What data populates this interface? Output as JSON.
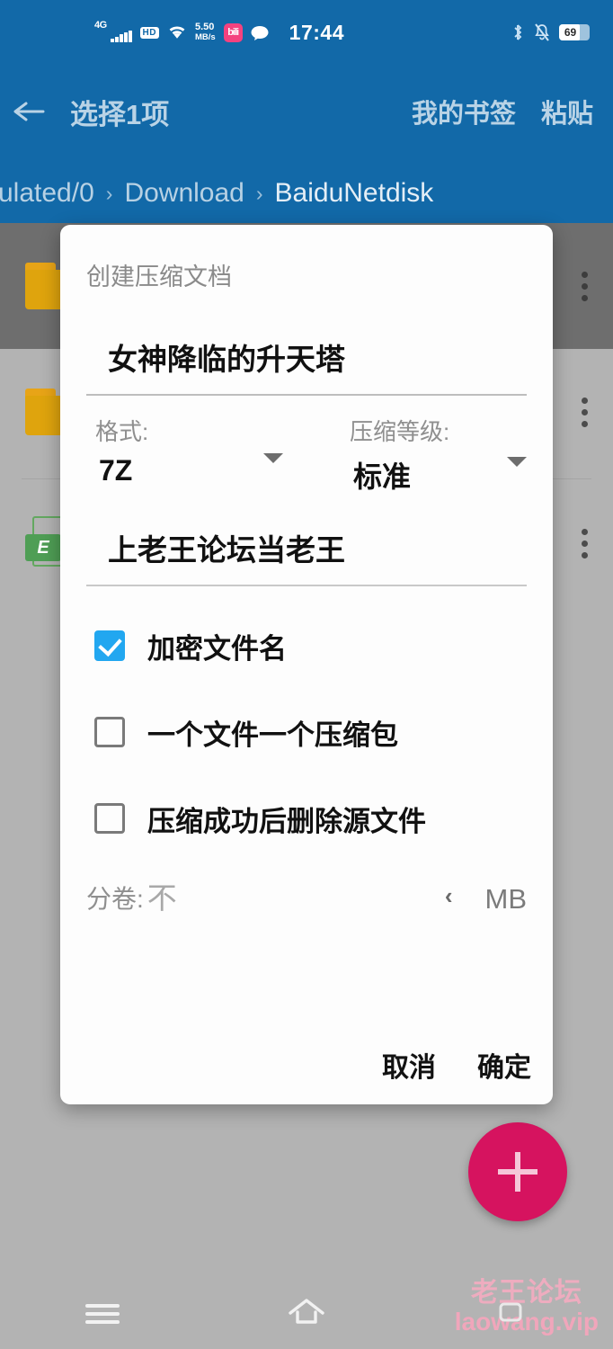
{
  "status_bar": {
    "network_type": "4G",
    "hd_badge": "HD",
    "net_speed_value": "5.50",
    "net_speed_unit": "MB/s",
    "app_icon_glyph": "bili",
    "time": "17:44",
    "battery_level": "69",
    "icons": [
      "signal-bars-icon",
      "hd-icon",
      "wifi-icon",
      "bilibili-app-icon",
      "message-bubble-icon",
      "bluetooth-icon",
      "bell-muted-icon",
      "battery-icon"
    ]
  },
  "action_bar": {
    "back_icon": "back-arrow-icon",
    "title": "选择1项",
    "bookmarks_label": "我的书签",
    "paste_label": "粘贴"
  },
  "breadcrumb": {
    "items": [
      "ulated/0",
      "Download",
      "BaiduNetdisk"
    ],
    "separator": "›"
  },
  "file_list": {
    "rows": [
      {
        "icon": "folder-icon",
        "selected": true,
        "menu": "overflow-menu-icon"
      },
      {
        "icon": "folder-icon",
        "selected": false,
        "menu": "overflow-menu-icon"
      },
      {
        "icon": "excel-file-icon",
        "icon_letter": "E",
        "selected": false,
        "menu": "overflow-menu-icon"
      }
    ]
  },
  "fab": {
    "icon": "plus-icon",
    "color": "#d6135f"
  },
  "watermark": {
    "line1": "老王论坛",
    "line2": "laowang.vip"
  },
  "nav_bar": {
    "recents_icon": "menu-icon",
    "home_icon": "home-icon"
  },
  "dialog": {
    "title": "创建压缩文档",
    "archive_name": "女神降临的升天塔",
    "format": {
      "label": "格式:",
      "value": "7Z",
      "caret": "chevron-down-icon"
    },
    "level": {
      "label": "压缩等级:",
      "value": "标准",
      "caret": "chevron-down-icon"
    },
    "password": "上老王论坛当老王",
    "checkboxes": [
      {
        "label": "加密文件名",
        "checked": true
      },
      {
        "label": "一个文件一个压缩包",
        "checked": false
      },
      {
        "label": "压缩成功后删除源文件",
        "checked": false
      }
    ],
    "split": {
      "label": "分卷:",
      "placeholder": "不",
      "chevron": "‹",
      "unit": "MB"
    },
    "cancel_label": "取消",
    "confirm_label": "确定"
  },
  "colors": {
    "toolbar_blue": "#1269a8",
    "accent_checkbox": "#22a7f0",
    "fab_pink": "#d6135f",
    "folder_orange": "#dfa40d"
  }
}
